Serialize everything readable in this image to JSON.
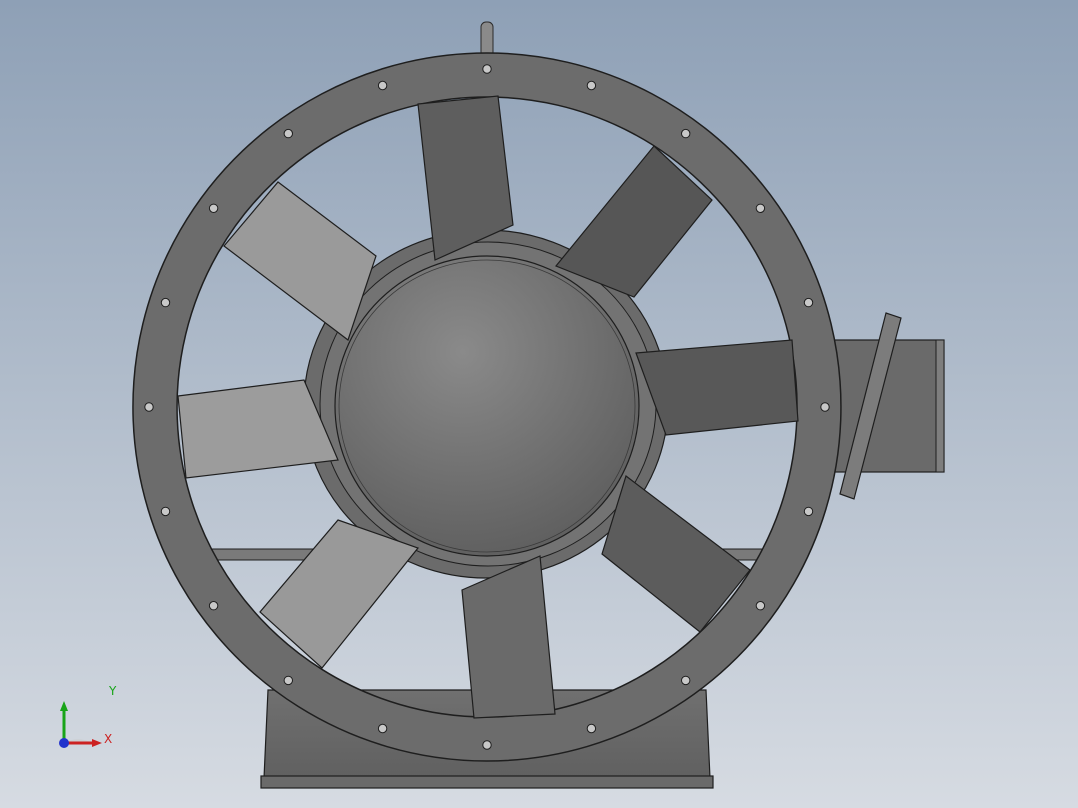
{
  "app": {
    "view": "cad-graphics-area",
    "model": "axial-fan"
  },
  "colors": {
    "background_top": "#8ea0b6",
    "background_bottom": "#d6dbe2",
    "metal_dark": "#5a5a5a",
    "metal_mid": "#6e6e6e",
    "metal_light": "#9b9b9b",
    "outline": "#1e1e1e",
    "axis_x": "#cc2222",
    "axis_y": "#18a418",
    "axis_z": "#2233cc"
  },
  "triad": {
    "x_label": "X",
    "y_label": "Y"
  },
  "fan": {
    "blade_count": 8,
    "bolt_hole_count": 20
  }
}
